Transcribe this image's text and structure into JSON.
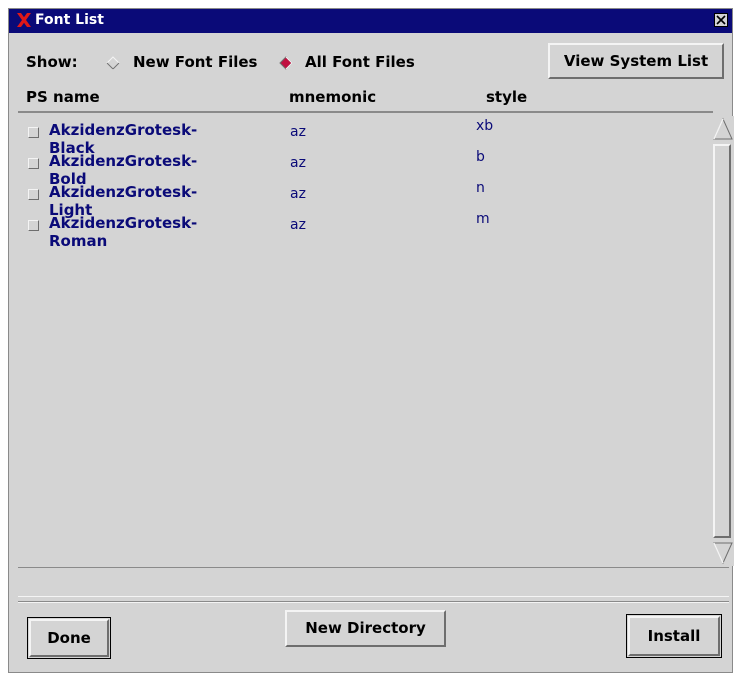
{
  "window": {
    "title": "Font List",
    "close_label": "×"
  },
  "show": {
    "label": "Show:",
    "options": [
      {
        "label": "New Font Files",
        "selected": false
      },
      {
        "label": "All Font Files",
        "selected": true
      }
    ]
  },
  "buttons": {
    "view_system_list": "View System List",
    "done": "Done",
    "new_directory": "New Directory",
    "install": "Install"
  },
  "columns": {
    "ps_name": "PS name",
    "mnemonic": "mnemonic",
    "style": "style"
  },
  "fonts": [
    {
      "ps_name": "AkzidenzGrotesk-Black",
      "mnemonic": "az",
      "style": "xb",
      "checked": false
    },
    {
      "ps_name": "AkzidenzGrotesk-Bold",
      "mnemonic": "az",
      "style": "b",
      "checked": false
    },
    {
      "ps_name": "AkzidenzGrotesk-Light",
      "mnemonic": "az",
      "style": "n",
      "checked": false
    },
    {
      "ps_name": "AkzidenzGrotesk-Roman",
      "mnemonic": "az",
      "style": "m",
      "checked": false
    }
  ],
  "status": "",
  "colors": {
    "titlebar": "#0a0a78",
    "text_blue": "#0a0a78",
    "window_bg": "#d4d4d4",
    "radio_selected": "#c01040"
  }
}
